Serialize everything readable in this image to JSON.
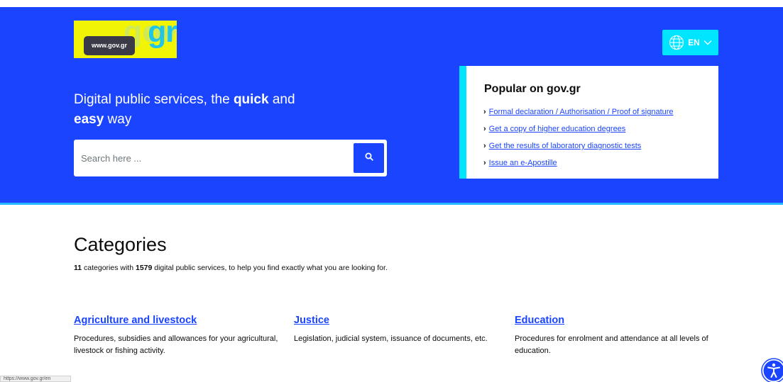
{
  "header": {
    "logo_tooltip": "www.gov.gr",
    "logo_text": "gr",
    "logo_text_hidden": "gov",
    "language": "EN"
  },
  "hero": {
    "tagline_part1": "Digital public services, the ",
    "tagline_bold1": "quick",
    "tagline_part2": " and ",
    "tagline_bold2": "easy",
    "tagline_part3": " way"
  },
  "search": {
    "placeholder": "Search here ..."
  },
  "popular": {
    "title": "Popular on gov.gr",
    "links": [
      "Formal declaration / Authorisation / Proof of signature",
      "Get a copy of higher education degrees",
      "Get the results of laboratory diagnostic tests",
      "Issue an e-Apostille"
    ]
  },
  "categories": {
    "title": "Categories",
    "count_categories": "11",
    "text_1": " categories with ",
    "count_services": "1579",
    "text_2": " digital public services, to help you find exactly what you are looking for.",
    "items": [
      {
        "title": "Agriculture and livestock",
        "description": "Procedures, subsidies and allowances for your agricultural, livestock or fishing activity."
      },
      {
        "title": "Justice",
        "description": "Legislation, judicial system, issuance of documents, etc."
      },
      {
        "title": "Education",
        "description": "Procedures for enrolment and attendance at all levels of education."
      }
    ]
  },
  "status_bar": {
    "url": "https://www.gov.gr/en"
  },
  "colors": {
    "primary": "#1b44ff",
    "accent_cyan": "#00e5ff",
    "logo_yellow": "#f1f505"
  },
  "icons": {
    "language": "globe-icon",
    "dropdown": "chevron-down-icon",
    "search": "search-icon",
    "accessibility": "accessibility-icon"
  }
}
